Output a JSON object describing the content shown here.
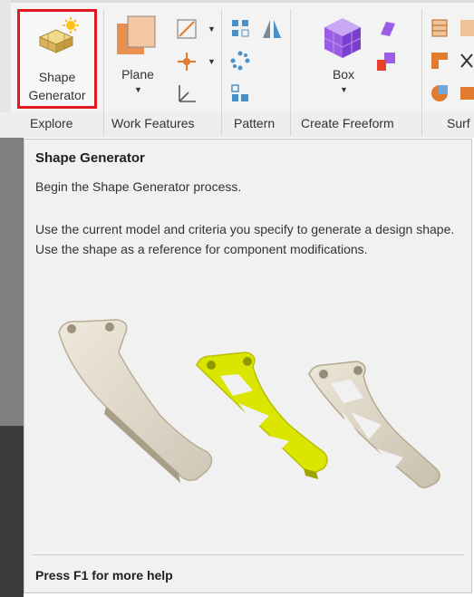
{
  "ribbon": {
    "shape_generator": {
      "line1": "Shape",
      "line2": "Generator"
    },
    "plane": {
      "label": "Plane"
    },
    "box": {
      "label": "Box"
    },
    "groups": {
      "explore": "Explore",
      "work_features": "Work Features",
      "pattern": "Pattern",
      "create_freeform": "Create Freeform",
      "surface": "Surf"
    },
    "highlight_color": "#e0181f"
  },
  "tooltip": {
    "title": "Shape Generator",
    "description": "Begin the Shape Generator process.",
    "body": "Use the current model and criteria you specify to generate a design shape. Use the shape as a reference for component modifications.",
    "footer": "Press F1 for more help",
    "accent_color": "#dbe600"
  }
}
